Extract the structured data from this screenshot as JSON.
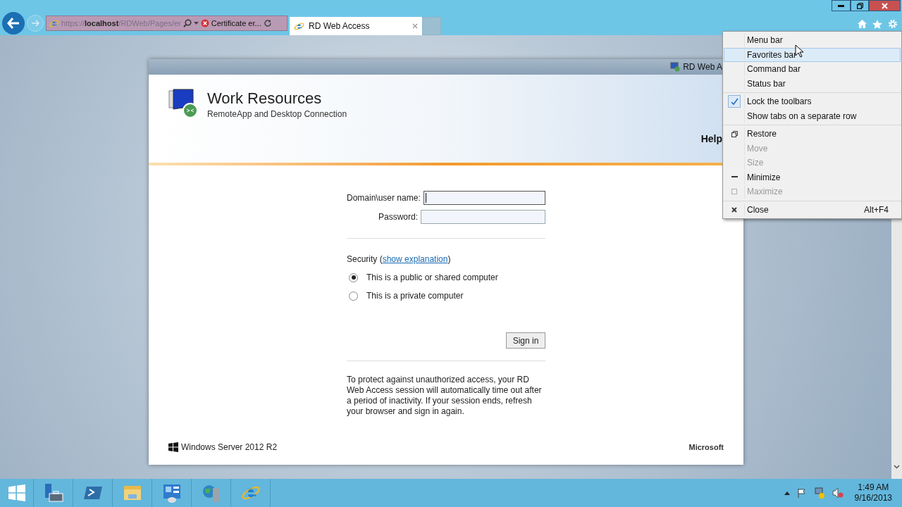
{
  "browser": {
    "url": "https://**localhost**/RDWeb/Pages/er",
    "certificate": "Certificate er...",
    "tabs": [
      {
        "label": "RD Web Access",
        "selected": true
      }
    ]
  },
  "page": {
    "site_tab": "RD Web A",
    "title": "Work Resources",
    "subtitle": "RemoteApp and Desktop Connection",
    "help": "Help",
    "fields": [
      {
        "label": "Domain\\user name:",
        "focused": true
      },
      {
        "label": "Password:",
        "focused": false
      }
    ],
    "security": {
      "prefix": "Security (",
      "link": "show explanation",
      "suffix": ")"
    },
    "options": [
      {
        "label": "This is a public or shared computer",
        "selected": true
      },
      {
        "label": "This is a private computer",
        "selected": false
      }
    ],
    "sign_in": "Sign in",
    "notice": "To protect against unauthorized access, your RD Web Access session will automatically time out after a period of inactivity. If your session ends, refresh your browser and sign in again.",
    "product": "Windows Server 2012 R2",
    "brand": "Microsoft"
  },
  "menu": [
    [
      {
        "label": "Menu bar",
        "checked": false,
        "disabled": false,
        "selected": false
      },
      {
        "label": "Favorites bar",
        "checked": false,
        "disabled": false,
        "selected": true
      },
      {
        "label": "Command bar",
        "checked": false,
        "disabled": false,
        "selected": false
      },
      {
        "label": "Status bar",
        "checked": false,
        "disabled": false,
        "selected": false
      }
    ],
    [
      {
        "label": "Lock the toolbars",
        "checked": true,
        "disabled": false,
        "selected": false
      },
      {
        "label": "Show tabs on a separate row",
        "checked": false,
        "disabled": false,
        "selected": false
      }
    ],
    [
      {
        "label": "Restore",
        "kind": "restore",
        "disabled": false,
        "selected": false
      },
      {
        "label": "Move",
        "kind": "plain",
        "disabled": true,
        "selected": false
      },
      {
        "label": "Size",
        "kind": "plain",
        "disabled": true,
        "selected": false
      },
      {
        "label": "Minimize",
        "kind": "minimize",
        "disabled": false,
        "selected": false
      },
      {
        "label": "Maximize",
        "kind": "maximize",
        "disabled": true,
        "selected": false
      }
    ],
    [
      {
        "label": "Close",
        "kind": "close",
        "shortcut": "Alt+F4",
        "disabled": false,
        "selected": false
      }
    ]
  ],
  "taskbar": {
    "apps": [
      {
        "kind": "server-manager"
      },
      {
        "kind": "powershell"
      },
      {
        "kind": "explorer"
      },
      {
        "kind": "control-panel"
      },
      {
        "kind": "tools"
      },
      {
        "kind": "browser"
      }
    ],
    "time": "1:49 AM",
    "date": "9/16/2013"
  }
}
